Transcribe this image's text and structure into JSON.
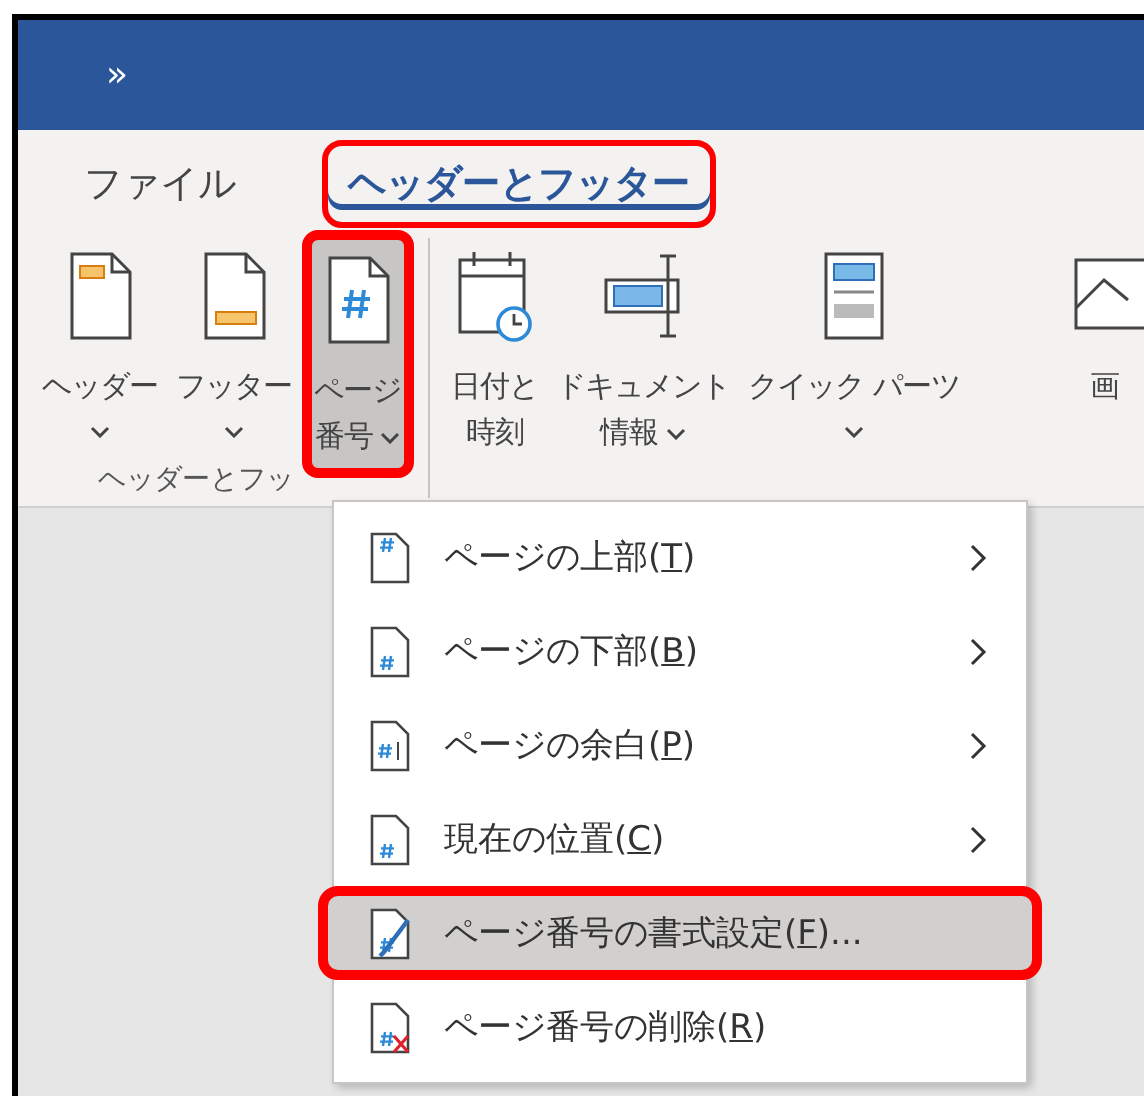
{
  "title_bar": {
    "overflow_glyph": "»"
  },
  "tabs": [
    {
      "label": "ファイル",
      "selected": false,
      "highlighted": false
    },
    {
      "label": "ヘッダーとフッター",
      "selected": true,
      "highlighted": true
    }
  ],
  "ribbon": {
    "buttons": [
      {
        "kind": "header",
        "lines": [
          "ヘッダー"
        ],
        "caret": true,
        "selected": false,
        "highlighted": false
      },
      {
        "kind": "footer",
        "lines": [
          "フッター"
        ],
        "caret": true,
        "selected": false,
        "highlighted": false
      },
      {
        "kind": "page-number",
        "lines": [
          "ページ",
          "番号"
        ],
        "caret": true,
        "selected": true,
        "highlighted": true
      },
      {
        "kind": "separator"
      },
      {
        "kind": "date-time",
        "lines": [
          "日付と",
          "時刻"
        ],
        "caret": false,
        "selected": false,
        "highlighted": false
      },
      {
        "kind": "doc-info",
        "lines": [
          "ドキュメント",
          "情報"
        ],
        "caret": true,
        "selected": false,
        "highlighted": false
      },
      {
        "kind": "quick-parts",
        "lines": [
          "クイック パーツ"
        ],
        "caret": true,
        "selected": false,
        "highlighted": false
      },
      {
        "kind": "picture",
        "lines": [
          "画"
        ],
        "caret": false,
        "selected": false,
        "highlighted": false
      }
    ],
    "group_label": "ヘッダーとフッ"
  },
  "menu": {
    "items": [
      {
        "kind": "top",
        "before": "ページの上部(",
        "key": "T",
        "after": ")",
        "submenu": true,
        "selected": false,
        "highlighted": false
      },
      {
        "kind": "bottom",
        "before": "ページの下部(",
        "key": "B",
        "after": ")",
        "submenu": true,
        "selected": false,
        "highlighted": false
      },
      {
        "kind": "margin",
        "before": "ページの余白(",
        "key": "P",
        "after": ")",
        "submenu": true,
        "selected": false,
        "highlighted": false
      },
      {
        "kind": "current",
        "before": "現在の位置(",
        "key": "C",
        "after": ")",
        "submenu": true,
        "selected": false,
        "highlighted": false
      },
      {
        "kind": "format",
        "before": "ページ番号の書式設定(",
        "key": "F",
        "after": ")...",
        "submenu": false,
        "selected": true,
        "highlighted": true
      },
      {
        "kind": "remove",
        "before": "ページ番号の削除(",
        "key": "R",
        "after": ")",
        "submenu": false,
        "selected": false,
        "highlighted": false
      }
    ]
  }
}
